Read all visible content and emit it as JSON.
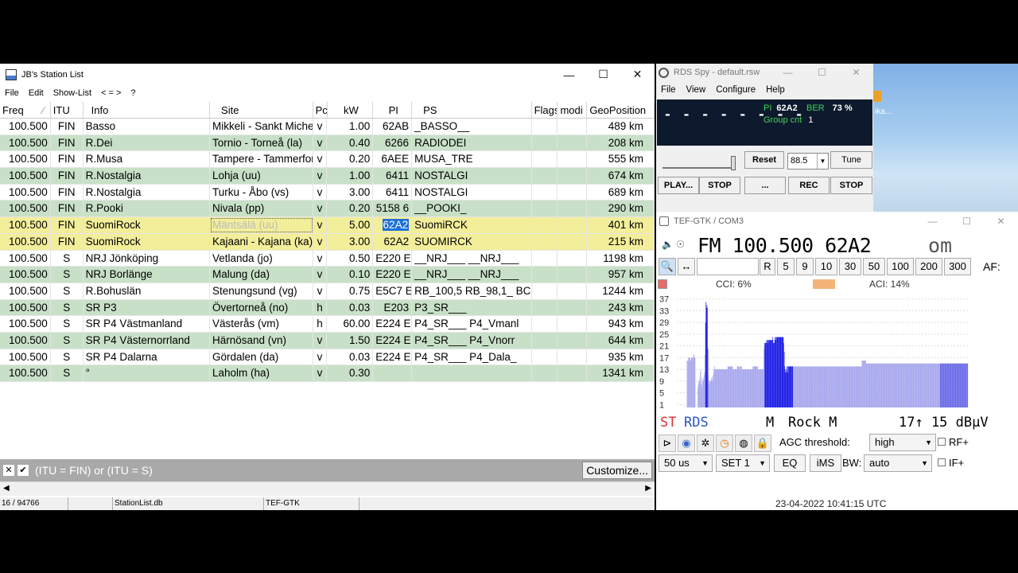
{
  "station_list": {
    "title": "JB's Station List",
    "menu": [
      "File",
      "Edit",
      "Show-List",
      "< = >",
      "?"
    ],
    "columns": [
      "Freq",
      "ITU",
      "Info",
      "Site",
      "Pc",
      "kW",
      "PI",
      "PS",
      "Flags",
      "modi",
      "GeoPosition"
    ],
    "sort_indicator": "⁄",
    "rows": [
      {
        "freq": "100.500",
        "itu": "FIN",
        "info": "Basso",
        "site": "Mikkeli - Sankt Michel",
        "pol": "v",
        "kw": "1.00",
        "pi": "62AB",
        "ps": "_BASSO__",
        "flags": "",
        "modi": "",
        "geo": "489 km",
        "bg": "w"
      },
      {
        "freq": "100.500",
        "itu": "FIN",
        "info": "R.Dei",
        "site": "Tornio - Torneå (la)",
        "pol": "v",
        "kw": "0.40",
        "pi": "6266",
        "ps": "RADIODEI",
        "flags": "",
        "modi": "",
        "geo": "208 km",
        "bg": "g"
      },
      {
        "freq": "100.500",
        "itu": "FIN",
        "info": "R.Musa",
        "site": "Tampere - Tammerfors",
        "pol": "v",
        "kw": "0.20",
        "pi": "6AEE",
        "ps": "MUSA_TRE",
        "flags": "",
        "modi": "",
        "geo": "555 km",
        "bg": "w"
      },
      {
        "freq": "100.500",
        "itu": "FIN",
        "info": "R.Nostalgia",
        "site": "Lohja (uu)",
        "pol": "v",
        "kw": "1.00",
        "pi": "6411",
        "ps": "NOSTALGI",
        "flags": "",
        "modi": "",
        "geo": "674 km",
        "bg": "g"
      },
      {
        "freq": "100.500",
        "itu": "FIN",
        "info": "R.Nostalgia",
        "site": "Turku - Åbo (vs)",
        "pol": "v",
        "kw": "3.00",
        "pi": "6411",
        "ps": "NOSTALGI",
        "flags": "",
        "modi": "",
        "geo": "689 km",
        "bg": "w"
      },
      {
        "freq": "100.500",
        "itu": "FIN",
        "info": "R.Pooki",
        "site": "Nivala (pp)",
        "pol": "v",
        "kw": "0.20",
        "pi": "5158 6",
        "ps": "__POOKI_",
        "flags": "",
        "modi": "",
        "geo": "290 km",
        "bg": "g"
      },
      {
        "freq": "100.500",
        "itu": "FIN",
        "info": "SuomiRock",
        "site": "Mäntsälä (uu)",
        "pol": "v",
        "kw": "5.00",
        "pi": "62A2",
        "ps": "SuomiRCK",
        "flags": "",
        "modi": "",
        "geo": "401 km",
        "bg": "y",
        "selected": true
      },
      {
        "freq": "100.500",
        "itu": "FIN",
        "info": "SuomiRock",
        "site": "Kajaani - Kajana (ka)",
        "pol": "v",
        "kw": "3.00",
        "pi": "62A2",
        "ps": "SUOMIRCK",
        "flags": "",
        "modi": "",
        "geo": "215 km",
        "bg": "y"
      },
      {
        "freq": "100.500",
        "itu": "S",
        "info": "NRJ Jönköping",
        "site": "Vetlanda (jo)",
        "pol": "v",
        "kw": "0.50",
        "pi": "E220 E",
        "ps": "__NRJ___ __NRJ___",
        "flags": "",
        "modi": "",
        "geo": "1198 km",
        "bg": "w"
      },
      {
        "freq": "100.500",
        "itu": "S",
        "info": "NRJ Borlänge",
        "site": "Malung (da)",
        "pol": "v",
        "kw": "0.10",
        "pi": "E220 E",
        "ps": "__NRJ___ __NRJ___",
        "flags": "",
        "modi": "",
        "geo": "957 km",
        "bg": "g"
      },
      {
        "freq": "100.500",
        "itu": "S",
        "info": "R.Bohuslän",
        "site": "Stenungsund (vg)",
        "pol": "v",
        "kw": "0.75",
        "pi": "E5C7 E",
        "ps": "RB_100,5 RB_98,1_ BC",
        "flags": "",
        "modi": "",
        "geo": "1244 km",
        "bg": "w"
      },
      {
        "freq": "100.500",
        "itu": "S",
        "info": "SR P3",
        "site": "Övertorneå (no)",
        "pol": "h",
        "kw": "0.03",
        "pi": "E203",
        "ps": "P3_SR___",
        "flags": "",
        "modi": "",
        "geo": "243 km",
        "bg": "g"
      },
      {
        "freq": "100.500",
        "itu": "S",
        "info": "SR P4 Västmanland",
        "site": "Västerås (vm)",
        "pol": "h",
        "kw": "60.00",
        "pi": "E224 E",
        "ps": "P4_SR___ P4_Vmanl",
        "flags": "",
        "modi": "",
        "geo": "943 km",
        "bg": "w"
      },
      {
        "freq": "100.500",
        "itu": "S",
        "info": "SR P4 Västernorrland",
        "site": "Härnösand (vn)",
        "pol": "v",
        "kw": "1.50",
        "pi": "E224 E",
        "ps": "P4_SR___ P4_Vnorr",
        "flags": "",
        "modi": "",
        "geo": "644 km",
        "bg": "g"
      },
      {
        "freq": "100.500",
        "itu": "S",
        "info": "SR P4 Dalarna",
        "site": "Gördalen (da)",
        "pol": "v",
        "kw": "0.03",
        "pi": "E224 E",
        "ps": "P4_SR___ P4_Dala_",
        "flags": "",
        "modi": "",
        "geo": "935 km",
        "bg": "w"
      },
      {
        "freq": "100.500",
        "itu": "S",
        "info": "°",
        "site": "Laholm (ha)",
        "pol": "v",
        "kw": "0.30",
        "pi": "",
        "ps": "",
        "flags": "",
        "modi": "",
        "geo": "1341 km",
        "bg": "g"
      }
    ],
    "filter": "(ITU = FIN) or (ITU = S)",
    "customize_label": "Customize...",
    "status": {
      "count": "16 / 94766",
      "db": "StationList.db",
      "source": "TEF-GTK"
    }
  },
  "rds_spy": {
    "title": "RDS Spy - default.rsw",
    "menu": [
      "File",
      "View",
      "Configure",
      "Help"
    ],
    "ps_display": "- - - - - - - -",
    "pi_label": "PI",
    "pi_value": "62A2",
    "ber_label": "BER",
    "ber_value": "73 %",
    "group_label": "Group cnt",
    "group_value": "1",
    "reset": "Reset",
    "freq_select": "88.5",
    "tune": "Tune",
    "play": "PLAY...",
    "stop1": "STOP",
    "more": "...",
    "rec": "REC",
    "stop2": "STOP"
  },
  "desktop": {
    "icon_label": "ika..."
  },
  "tef": {
    "title": "TEF-GTK / COM3",
    "freq_line": "FM 100.500 62A2",
    "pty_short": "om",
    "step_buttons": [
      "R",
      "5",
      "9",
      "10",
      "30",
      "50",
      "100",
      "200",
      "300"
    ],
    "af_label": "AF:",
    "cci": "CCI: 6%",
    "aci": "ACI: 14%",
    "y_ticks": [
      "37",
      "33",
      "29",
      "25",
      "21",
      "17",
      "13",
      "9",
      "5",
      "1"
    ],
    "st": "ST",
    "rds": "RDS",
    "ms": "M",
    "pty": "Rock M",
    "signal": "17↑ 15 dBµV",
    "agc_label": "AGC threshold:",
    "agc_value": "high",
    "rf_label": "RF+",
    "deemph": "50 us",
    "set": "SET 1",
    "eq": "EQ",
    "ims": "iMS",
    "bw_label": "BW:",
    "bw_value": "auto",
    "if_label": "IF+",
    "datetime": "23-04-2022 10:41:15 UTC",
    "colors": {
      "bar_light": "#a9a9ee",
      "bar_dark": "#2121e6",
      "cci_marker": "#e86a6a",
      "aci_marker": "#f4b479"
    },
    "spectrum": [
      0,
      0,
      0,
      0,
      0,
      0,
      0,
      0,
      0,
      0,
      0,
      0,
      0,
      0,
      0,
      0,
      0,
      0,
      0,
      0,
      0,
      16,
      16,
      16,
      17,
      17,
      17,
      17,
      16,
      16,
      17,
      17,
      17,
      17,
      17,
      18,
      18,
      17,
      17,
      0,
      0,
      0,
      0,
      0,
      7,
      9,
      8,
      9,
      10,
      12,
      13,
      8,
      7,
      10,
      9,
      9,
      10,
      12,
      11,
      18,
      29,
      36,
      34,
      35,
      34,
      20,
      11,
      8,
      9,
      9,
      9,
      9,
      10,
      9,
      10,
      11,
      9,
      12,
      13,
      14,
      13,
      13,
      13,
      13,
      13,
      13,
      13,
      13,
      13,
      13,
      13,
      13,
      13,
      13,
      13,
      13,
      13,
      13,
      13,
      13,
      13,
      13,
      13,
      13,
      13,
      13,
      13,
      14,
      14,
      14,
      14,
      14,
      14,
      14,
      14,
      14,
      14,
      14,
      13,
      13,
      13,
      13,
      13,
      13,
      13,
      13,
      13,
      14,
      14,
      14,
      14,
      14,
      14,
      13,
      14,
      14,
      14,
      13,
      13,
      13,
      13,
      13,
      13,
      13,
      13,
      13,
      13,
      13,
      13,
      13,
      13,
      13,
      13,
      13,
      13,
      13,
      13,
      13,
      13,
      13,
      14,
      14,
      14,
      14,
      14,
      14,
      14,
      14,
      14,
      14,
      14,
      13,
      13,
      13,
      13,
      13,
      13,
      13,
      13,
      13,
      13,
      13,
      13,
      20,
      21,
      22,
      22,
      22,
      22,
      23,
      23,
      22,
      23,
      23,
      23,
      23,
      23,
      23,
      23,
      23,
      23,
      23,
      24,
      22,
      22,
      22,
      23,
      24,
      24,
      23,
      24,
      24,
      24,
      24,
      24,
      24,
      24,
      24,
      24,
      24,
      24,
      24,
      24,
      24,
      24,
      22,
      19,
      14,
      13,
      12,
      12,
      13,
      14,
      14,
      12,
      14,
      14,
      14,
      14,
      14,
      14,
      14,
      14,
      14,
      14,
      14,
      14,
      14,
      14,
      14,
      14,
      14,
      14,
      14,
      14,
      14,
      14,
      14,
      14,
      14,
      14,
      14,
      14,
      14,
      14,
      14,
      14,
      14,
      14,
      14,
      14,
      14,
      14,
      14,
      14,
      14,
      14,
      14,
      14,
      14,
      14,
      14,
      14,
      14,
      14,
      14,
      14,
      14,
      14,
      14,
      14,
      14,
      14,
      14,
      14,
      14,
      14,
      14,
      14,
      14,
      14,
      14,
      14,
      14,
      14,
      14,
      14,
      14,
      14,
      14,
      14,
      14,
      14,
      14,
      14,
      14,
      14,
      14,
      14,
      14,
      14,
      14,
      14,
      14,
      14,
      14,
      14,
      14,
      14,
      14,
      14,
      14,
      14,
      14,
      14,
      14,
      14,
      14,
      14,
      14,
      14,
      14,
      14,
      14,
      14,
      14,
      14,
      14,
      14,
      14,
      14,
      14,
      14,
      14,
      14,
      14,
      14,
      14,
      14,
      14,
      14,
      14,
      14,
      14,
      14,
      14,
      14,
      14,
      14,
      14,
      14,
      14,
      14,
      14,
      14,
      14,
      14,
      14,
      14,
      14,
      14,
      14,
      14,
      14,
      14,
      14,
      14,
      14,
      14,
      14,
      16,
      16,
      16,
      16,
      16,
      16,
      16,
      16,
      16,
      15,
      15,
      15,
      15,
      15,
      15,
      15,
      15,
      15,
      15,
      15,
      15,
      15,
      15,
      15,
      15,
      15,
      15,
      15,
      15,
      15,
      15,
      15,
      15,
      15,
      15,
      15,
      15,
      15,
      15,
      15,
      15,
      15,
      15,
      15,
      15,
      15,
      15,
      15,
      15,
      15,
      15,
      15,
      15,
      15,
      15,
      15,
      15,
      15,
      15,
      15,
      15,
      15,
      15,
      15,
      15,
      15,
      15,
      15,
      15,
      15,
      15,
      15,
      15,
      15,
      15,
      15,
      15,
      15,
      15,
      15,
      15,
      15,
      15,
      15,
      15,
      15,
      15,
      15,
      15,
      15,
      15,
      15,
      15,
      15,
      15,
      15,
      15,
      15,
      15,
      15,
      15,
      15,
      15,
      15,
      15,
      15,
      15,
      15,
      15,
      15,
      15,
      15,
      15,
      15,
      15,
      15,
      15,
      15,
      15,
      15,
      15,
      15,
      15,
      15,
      15,
      15,
      15,
      15,
      15,
      15,
      15,
      15,
      15,
      15,
      15,
      15,
      15,
      15,
      15,
      15,
      15,
      15,
      15,
      15,
      15,
      15,
      15,
      15,
      15,
      15,
      15,
      15,
      15,
      15,
      15,
      15,
      15,
      15,
      15,
      15,
      15,
      15,
      15,
      15,
      15,
      15,
      15,
      15,
      15,
      15,
      15,
      15,
      15,
      15,
      15,
      15,
      15,
      15,
      15,
      15,
      15,
      15,
      15,
      15,
      15,
      15,
      15,
      15,
      15,
      15,
      15,
      15,
      15,
      15,
      15,
      15,
      15,
      15,
      15,
      15,
      15,
      15,
      15,
      15,
      15,
      15,
      15,
      15,
      15,
      15,
      15,
      15,
      15,
      15,
      15,
      15,
      15,
      15,
      15,
      15,
      15,
      15,
      15,
      15
    ]
  }
}
